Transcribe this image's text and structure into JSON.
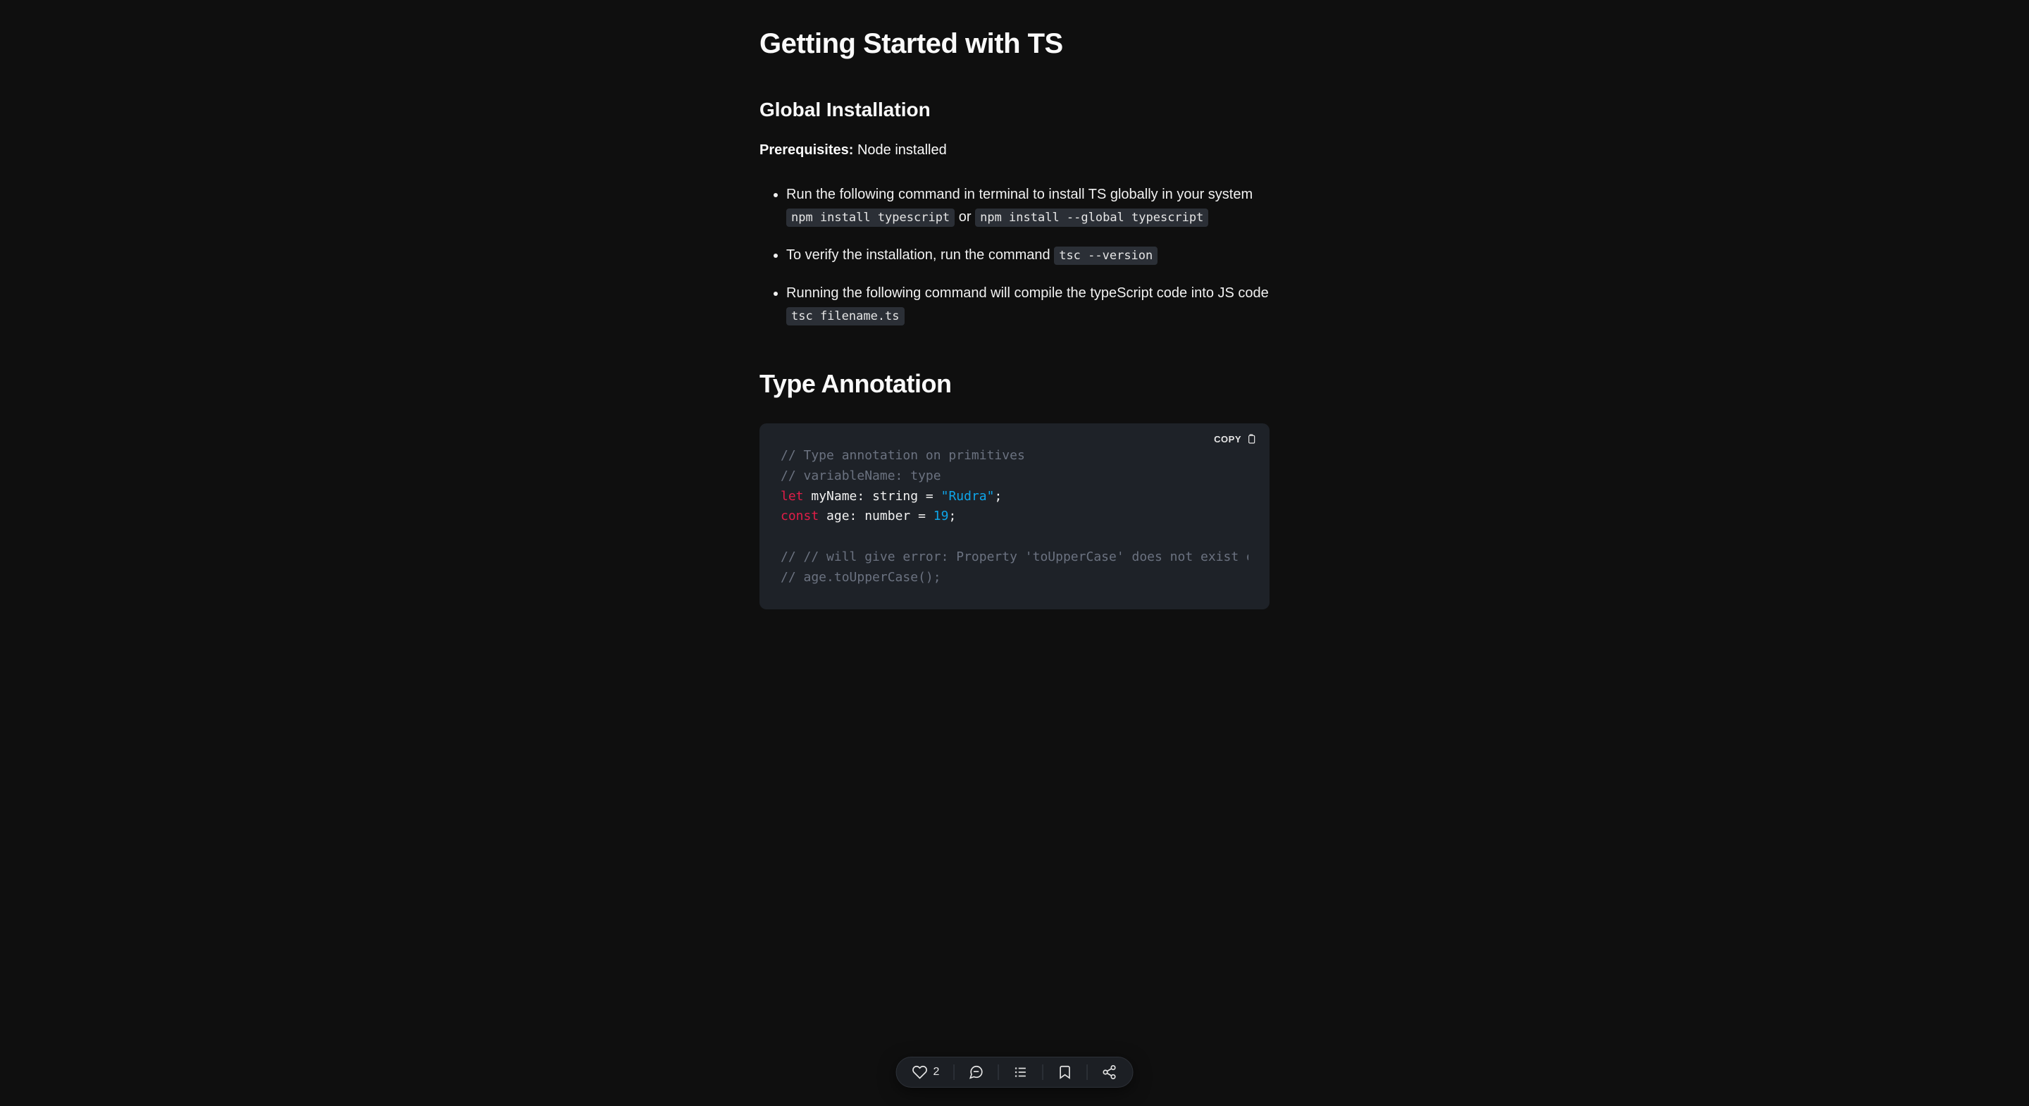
{
  "title": "Getting Started with TS",
  "section1": {
    "heading": "Global Installation",
    "prereq_label": "Prerequisites:",
    "prereq_value": "Node installed",
    "step1_text": "Run the following command in terminal to install TS globally in your system",
    "step1_code1": "npm install typescript",
    "step1_or": "or",
    "step1_code2": "npm install --global typescript",
    "step2_text": "To verify the installation, run the command",
    "step2_code": "tsc --version",
    "step3_text": "Running the following command will compile the typeScript code into JS code",
    "step3_code": "tsc filename.ts"
  },
  "section2": {
    "heading": "Type Annotation",
    "copy_label": "COPY",
    "code": {
      "c1": "// Type annotation on primitives",
      "c2": "// variableName: type",
      "l3_kw": "let",
      "l3_var": " myName: ",
      "l3_type": "string",
      "l3_eq": " = ",
      "l3_str": "\"Rudra\"",
      "l3_end": ";",
      "l4_kw": "const",
      "l4_var": " age: ",
      "l4_type": "number",
      "l4_eq": " = ",
      "l4_num": "19",
      "l4_end": ";",
      "c5": "// // will give error: Property 'toUpperCase' does not exist on type 'num",
      "c6": "// age.toUpperCase();"
    }
  },
  "actionbar": {
    "like_count": "2"
  }
}
